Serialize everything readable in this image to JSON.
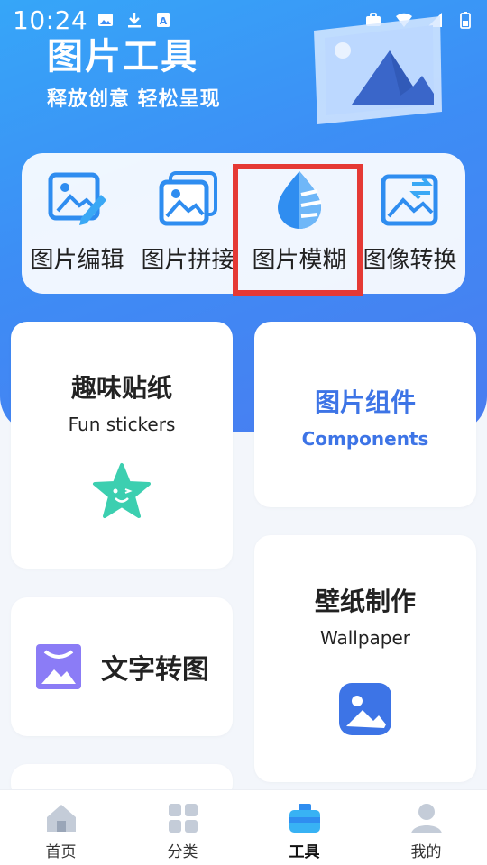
{
  "status_bar": {
    "time": "10:24",
    "left_icons": [
      "image-icon",
      "download-icon",
      "a-box-icon"
    ],
    "right_icons": [
      "briefcase-icon",
      "wifi-icon",
      "signal-icon",
      "battery-icon"
    ]
  },
  "header": {
    "title": "图片工具",
    "subtitle": "释放创意 轻松呈现"
  },
  "quick_tools": [
    {
      "label": "图片编辑",
      "icon": "image-edit-icon"
    },
    {
      "label": "图片拼接",
      "icon": "image-stack-icon"
    },
    {
      "label": "图片模糊",
      "icon": "blur-drop-icon"
    },
    {
      "label": "图像转换",
      "icon": "image-convert-icon"
    }
  ],
  "cards": {
    "fun_stickers": {
      "title": "趣味贴纸",
      "subtitle": "Fun stickers",
      "icon": "star-face-icon"
    },
    "components": {
      "title": "图片组件",
      "subtitle": "Components"
    },
    "text_to_image": {
      "title": "文字转图",
      "icon": "text-image-icon"
    },
    "wallpaper": {
      "title": "壁纸制作",
      "subtitle": "Wallpaper",
      "icon": "wallpaper-image-icon"
    }
  },
  "bottom_nav": [
    {
      "label": "首页",
      "icon": "home-icon"
    },
    {
      "label": "分类",
      "icon": "grid-icon"
    },
    {
      "label": "工具",
      "icon": "toolbox-icon",
      "active": true
    },
    {
      "label": "我的",
      "icon": "profile-icon"
    }
  ],
  "colors": {
    "hero_gradient_start": "#36a6f8",
    "hero_gradient_end": "#4a7cf0",
    "accent_blue": "#3d74e6",
    "highlight_red": "#e53935",
    "sticker_green": "#3ccfb0",
    "text_image_purple": "#8b7cf6"
  }
}
